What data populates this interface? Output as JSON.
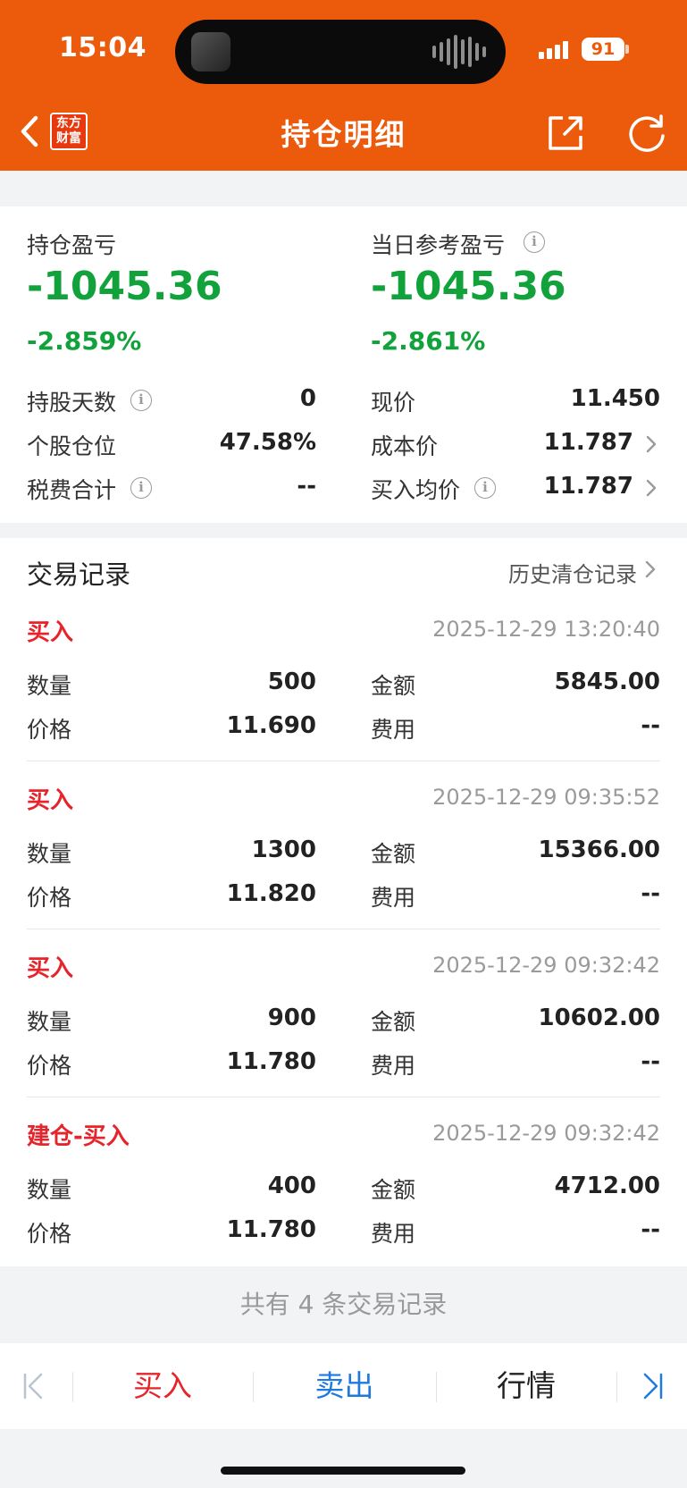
{
  "status": {
    "time": "15:04",
    "battery": "91"
  },
  "nav": {
    "logo_line1": "东方",
    "logo_line2": "财富",
    "title": "持仓明细"
  },
  "summary": {
    "hold_pl_label": "持仓盈亏",
    "hold_pl_value": "-1045.36",
    "hold_pl_pct": "-2.859%",
    "day_pl_label": "当日参考盈亏",
    "day_pl_value": "-1045.36",
    "day_pl_pct": "-2.861%",
    "rows": [
      {
        "left_label": "持股天数",
        "left_value": "0",
        "right_label": "现价",
        "right_value": "11.450"
      },
      {
        "left_label": "个股仓位",
        "left_value": "47.58%",
        "right_label": "成本价",
        "right_value": "11.787"
      },
      {
        "left_label": "税费合计",
        "left_value": "--",
        "right_label": "买入均价",
        "right_value": "11.787"
      }
    ]
  },
  "records": {
    "title": "交易记录",
    "history_link": "历史清仓记录",
    "qty_label": "数量",
    "amount_label": "金额",
    "price_label": "价格",
    "fee_label": "费用",
    "items": [
      {
        "type": "买入",
        "time": "2025-12-29 13:20:40",
        "qty": "500",
        "amount": "5845.00",
        "price": "11.690",
        "fee": "--"
      },
      {
        "type": "买入",
        "time": "2025-12-29 09:35:52",
        "qty": "1300",
        "amount": "15366.00",
        "price": "11.820",
        "fee": "--"
      },
      {
        "type": "买入",
        "time": "2025-12-29 09:32:42",
        "qty": "900",
        "amount": "10602.00",
        "price": "11.780",
        "fee": "--"
      },
      {
        "type": "建仓-买入",
        "time": "2025-12-29 09:32:42",
        "qty": "400",
        "amount": "4712.00",
        "price": "11.780",
        "fee": "--"
      }
    ],
    "count_text": "共有 4 条交易记录"
  },
  "toolbar": {
    "buy": "买入",
    "sell": "卖出",
    "quote": "行情"
  },
  "colors": {
    "brand": "#ec5a0b",
    "loss_green": "#11a23b",
    "buy_red": "#e5242c",
    "sell_blue": "#1f7ae0"
  }
}
